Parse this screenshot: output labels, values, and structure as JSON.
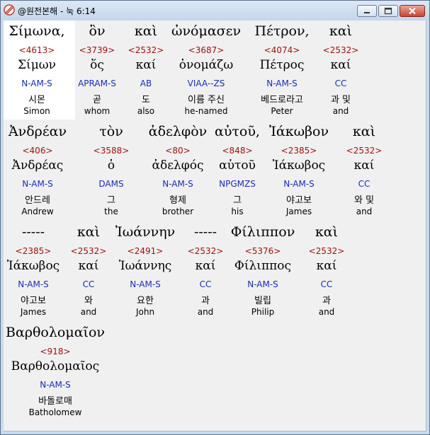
{
  "window": {
    "title": "@원전본해 - 눅 6:14"
  },
  "rows": [
    {
      "words": [
        {
          "greek": "Σίμωνα,",
          "strong": "<4613>",
          "lemma": "Σίμων",
          "parse": "N-AM-S",
          "korean": "시몬",
          "english": "Simon"
        },
        {
          "greek": "ὃν",
          "strong": "<3739>",
          "lemma": "ὅς",
          "parse": "APRAM-S",
          "korean": "곧",
          "english": "whom"
        },
        {
          "greek": "καὶ",
          "strong": "<2532>",
          "lemma": "καί",
          "parse": "AB",
          "korean": "도",
          "english": "also"
        },
        {
          "greek": "ὠνόμασεν",
          "strong": "<3687>",
          "lemma": "ὀνομάζω",
          "parse": "VIAA--ZS",
          "korean": "이름 주신",
          "english": "he-named"
        },
        {
          "greek": "Πέτρον,",
          "strong": "<4074>",
          "lemma": "Πέτρος",
          "parse": "N-AM-S",
          "korean": "베드로라고",
          "english": "Peter"
        },
        {
          "greek": "καὶ",
          "strong": "<2532>",
          "lemma": "καί",
          "parse": "CC",
          "korean": "과 및",
          "english": "and"
        }
      ]
    },
    {
      "words": [
        {
          "greek": "Ἀνδρέαν",
          "strong": "<406>",
          "lemma": "Ἀνδρέας",
          "parse": "N-AM-S",
          "korean": "안드레",
          "english": "Andrew"
        },
        {
          "greek": "τὸν",
          "strong": "<3588>",
          "lemma": "ὁ",
          "parse": "DAMS",
          "korean": "그",
          "english": "the"
        },
        {
          "greek": "ἀδελφὸν",
          "strong": "<80>",
          "lemma": "ἀδελφός",
          "parse": "N-AM-S",
          "korean": "형제",
          "english": "brother"
        },
        {
          "greek": "αὐτοῦ,",
          "strong": "<848>",
          "lemma": "αὑτοῦ",
          "parse": "NPGMZS",
          "korean": "그",
          "english": "his"
        },
        {
          "greek": "Ἰάκωβον",
          "strong": "<2385>",
          "lemma": "Ἰάκωβος",
          "parse": "N-AM-S",
          "korean": "야고보",
          "english": "James"
        },
        {
          "greek": "καὶ",
          "strong": "<2532>",
          "lemma": "καί",
          "parse": "CC",
          "korean": "와 및",
          "english": "and"
        }
      ]
    },
    {
      "words": [
        {
          "greek": "-----",
          "strong": "<2385>",
          "lemma": "Ἰάκωβος",
          "parse": "N-AM-S",
          "korean": "야고보",
          "english": "James"
        },
        {
          "greek": "καὶ",
          "strong": "<2532>",
          "lemma": "καί",
          "parse": "CC",
          "korean": "와",
          "english": "and"
        },
        {
          "greek": "Ἰωάννην",
          "strong": "<2491>",
          "lemma": "Ἰωάννης",
          "parse": "N-AM-S",
          "korean": "요한",
          "english": "John"
        },
        {
          "greek": "-----",
          "strong": "<2532>",
          "lemma": "καί",
          "parse": "CC",
          "korean": "과",
          "english": "and"
        },
        {
          "greek": "Φίλιππον",
          "strong": "<5376>",
          "lemma": "Φίλιππος",
          "parse": "N-AM-S",
          "korean": "빌립",
          "english": "Philip"
        },
        {
          "greek": "καὶ",
          "strong": "<2532>",
          "lemma": "καί",
          "parse": "CC",
          "korean": "과",
          "english": "and"
        }
      ]
    },
    {
      "words": [
        {
          "greek": "Βαρθολομαῖον",
          "strong": "<918>",
          "lemma": "Βαρθολομαῖος",
          "parse": "N-AM-S",
          "korean": "바돌로매",
          "english": "Batholomew"
        }
      ]
    }
  ]
}
